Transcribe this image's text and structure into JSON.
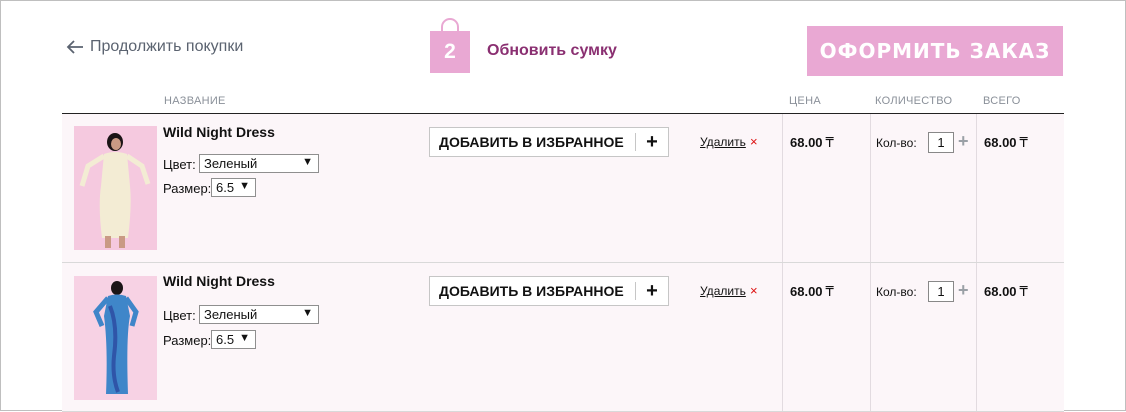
{
  "header": {
    "continue_label": "Продолжить покупки",
    "bag_count": "2",
    "update_label": "Обновить сумку",
    "checkout_label": "ОФОРМИТЬ ЗАКАЗ"
  },
  "columns": {
    "name": "НАЗВАНИЕ",
    "price": "ЦЕНА",
    "qty": "КОЛИЧЕСТВО",
    "total": "ВСЕГО"
  },
  "colors": {
    "accent": "#8a2f71",
    "checkout_bg": "#e9a8d3",
    "bag": "#e9a8d3",
    "remove_x": "#dd1111"
  },
  "items": [
    {
      "name": "Wild Night Dress",
      "color_label": "Цвет:",
      "color_value": "Зеленый",
      "size_label": "Размер:",
      "size_value": "6.5",
      "fav_label": "ДОБАВИТЬ В ИЗБРАННОЕ",
      "fav_plus": "+",
      "remove_label": "Удалить",
      "remove_icon": "×",
      "price": "68.00",
      "currency": "₸",
      "qty_label": "Кол-во:",
      "qty_value": "1",
      "qty_plus": "+",
      "total": "68.00"
    },
    {
      "name": "Wild Night Dress",
      "color_label": "Цвет:",
      "color_value": "Зеленый",
      "size_label": "Размер:",
      "size_value": "6.5",
      "fav_label": "ДОБАВИТЬ В ИЗБРАННОЕ",
      "fav_plus": "+",
      "remove_label": "Удалить",
      "remove_icon": "×",
      "price": "68.00",
      "currency": "₸",
      "qty_label": "Кол-во:",
      "qty_value": "1",
      "qty_plus": "+",
      "total": "68.00"
    }
  ]
}
